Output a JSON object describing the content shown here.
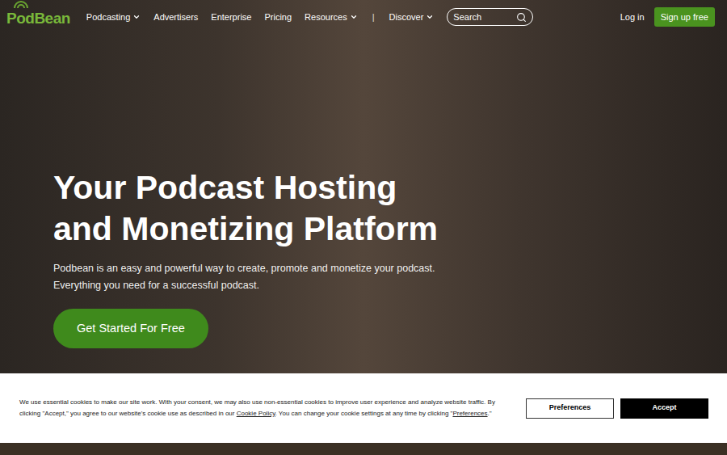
{
  "logo": {
    "text": "PodBean"
  },
  "nav": {
    "items": [
      {
        "label": "Podcasting",
        "kind": "link",
        "has_menu": true
      },
      {
        "label": "Advertisers",
        "kind": "link",
        "has_menu": false
      },
      {
        "label": "Enterprise",
        "kind": "link",
        "has_menu": false
      },
      {
        "label": "Pricing",
        "kind": "link",
        "has_menu": false
      },
      {
        "label": "Resources",
        "kind": "link",
        "has_menu": true
      },
      {
        "label": "|",
        "kind": "separator",
        "has_menu": false
      },
      {
        "label": "Discover",
        "kind": "link",
        "has_menu": true
      }
    ],
    "search": {
      "placeholder": "Search"
    },
    "login": "Log in",
    "signup": "Sign up free"
  },
  "hero": {
    "heading_lines": [
      "Your Podcast Hosting",
      "and Monetizing Platform"
    ],
    "description": "Podbean is an easy and powerful way to create, promote and monetize your podcast. Everything you need for a successful podcast.",
    "cta": "Get Started For Free"
  },
  "cookie_banner": {
    "text_parts": [
      {
        "text": "We use essential cookies to make our site work. With your consent, we may also use non-essential cookies to improve user experience and analyze website traffic. By clicking \"Accept,\" you agree to our website's cookie use as described in our ",
        "link": false
      },
      {
        "text": "Cookie Policy",
        "link": true
      },
      {
        "text": ". You can change your cookie settings at any time by clicking \"",
        "link": false
      },
      {
        "text": "Preferences",
        "link": true
      },
      {
        "text": ".\"",
        "link": false
      }
    ],
    "buttons": [
      {
        "label": "Preferences",
        "kind": "secondary"
      },
      {
        "label": "Accept",
        "kind": "primary"
      }
    ]
  }
}
